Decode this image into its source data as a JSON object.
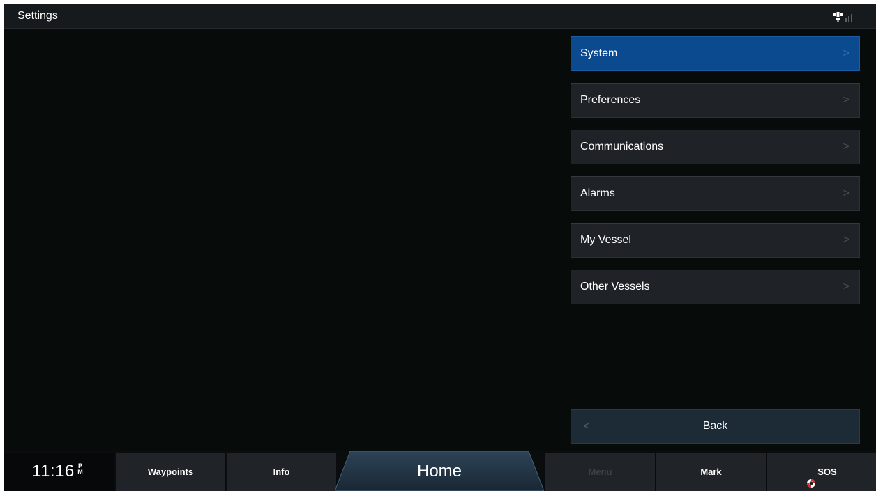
{
  "titlebar": {
    "title": "Settings",
    "status_icon": "gps-signal-icon"
  },
  "menu": {
    "items": [
      {
        "label": "System",
        "selected": true
      },
      {
        "label": "Preferences",
        "selected": false
      },
      {
        "label": "Communications",
        "selected": false
      },
      {
        "label": "Alarms",
        "selected": false
      },
      {
        "label": "My Vessel",
        "selected": false
      },
      {
        "label": "Other Vessels",
        "selected": false
      }
    ],
    "chevron": ">",
    "back_chevron": "<",
    "back_label": "Back"
  },
  "bottombar": {
    "time": "11:16",
    "ampm_top": "P",
    "ampm_bottom": "M",
    "waypoints": "Waypoints",
    "info": "Info",
    "home": "Home",
    "menu": "Menu",
    "mark": "Mark",
    "sos": "SOS",
    "sos_icon": "lifebuoy-icon"
  },
  "colors": {
    "selected_bg": "#0c4a8f",
    "item_bg": "#1f2226",
    "sos_red": "#e0262a"
  }
}
